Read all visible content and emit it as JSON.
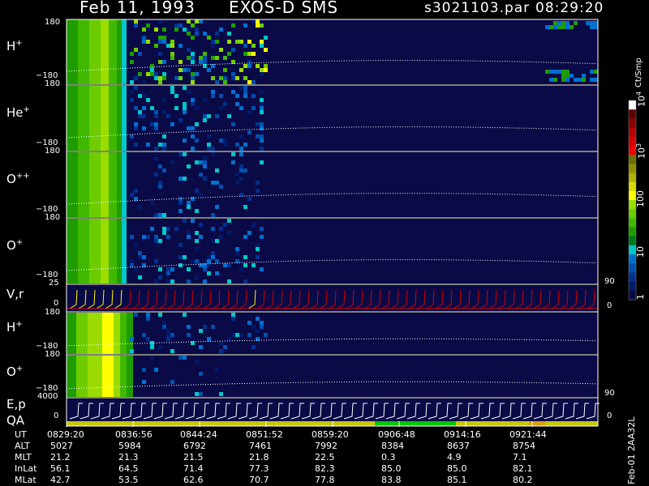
{
  "header": {
    "date": "Feb 11, 1993",
    "instrument": "EXOS-D SMS",
    "file": "s3021103.par",
    "time": "08:29:20"
  },
  "colorbar": {
    "unit": "Ct/Smp",
    "ticks": [
      "1",
      "10",
      "100",
      "10",
      "10"
    ],
    "tick_exponents": [
      "",
      "",
      "",
      "3",
      "4"
    ],
    "colors": [
      "#ffffff",
      "#5a0000",
      "#8a0000",
      "#b00000",
      "#d40000",
      "#f00000",
      "#6e6e00",
      "#8f8f00",
      "#b0b000",
      "#d8d800",
      "#ffff00",
      "#9adc00",
      "#6ccc00",
      "#40b800",
      "#1e9c00",
      "#007a20",
      "#00c8c8",
      "#0070d0",
      "#0050b0",
      "#003090",
      "#001a6a",
      "#0a0a46"
    ]
  },
  "panels": [
    {
      "label": "H",
      "sup": "+",
      "ytop": "180",
      "ybot": "−180",
      "right_label": ""
    },
    {
      "label": "He",
      "sup": "+",
      "ytop": "180",
      "ybot": "−180",
      "right_label": ""
    },
    {
      "label": "O",
      "sup": "++",
      "ytop": "180",
      "ybot": "−180",
      "right_label": ""
    },
    {
      "label": "O",
      "sup": "+",
      "ytop": "180",
      "ybot": "−180",
      "right_label": "90"
    },
    {
      "label": "V,r",
      "sup": "",
      "ytop": "25",
      "ybot": "0",
      "right_label": "0"
    },
    {
      "label": "H",
      "sup": "+",
      "ytop": "180",
      "ybot": "−180",
      "right_label": ""
    },
    {
      "label": "O",
      "sup": "+",
      "ytop": "180",
      "ybot": "−180",
      "right_label": "90"
    },
    {
      "label": "E,p",
      "sup": "",
      "ytop": "4000",
      "ybot": "0",
      "right_label": "0"
    }
  ],
  "qa_label": "QA",
  "orbit_table": {
    "row_labels": [
      "UT",
      "ALT",
      "MLT",
      "InLat",
      "MLat"
    ],
    "columns": [
      [
        "0829:20",
        "5027",
        "21.2",
        "56.1",
        "42.7"
      ],
      [
        "0836:56",
        "5984",
        "21.3",
        "64.5",
        "53.5"
      ],
      [
        "0844:24",
        "6792",
        "21.5",
        "71.4",
        "62.6"
      ],
      [
        "0851:52",
        "7461",
        "21.8",
        "77.3",
        "70.7"
      ],
      [
        "0859:20",
        "7992",
        "22.5",
        "82.3",
        "77.8"
      ],
      [
        "0906:48",
        "8384",
        "0.3",
        "85.0",
        "83.8"
      ],
      [
        "0914:16",
        "8637",
        "4.9",
        "85.0",
        "85.1"
      ],
      [
        "0921:44",
        "8754",
        "7.1",
        "82.1",
        "80.2"
      ]
    ]
  },
  "side_note": "Feb-01 2AA32L",
  "chart_data": {
    "type": "heatmap",
    "title": "Feb 11, 1993   EXOS-D SMS",
    "xlabel": "UT",
    "x_ticks": [
      "0829:20",
      "0836:56",
      "0844:24",
      "0851:52",
      "0859:20",
      "0906:48",
      "0914:16",
      "0921:44"
    ],
    "colorbar_unit": "Ct/Smp",
    "colorbar_range": [
      1,
      10000
    ],
    "colorbar_scale": "log",
    "series": [
      {
        "name": "H+",
        "ylim": [
          -180,
          180
        ]
      },
      {
        "name": "He+",
        "ylim": [
          -180,
          180
        ]
      },
      {
        "name": "O++",
        "ylim": [
          -180,
          180
        ]
      },
      {
        "name": "O+",
        "ylim": [
          -180,
          180
        ]
      },
      {
        "name": "V,r",
        "ylim": [
          0,
          25
        ]
      },
      {
        "name": "H+",
        "ylim": [
          -180,
          180
        ]
      },
      {
        "name": "O+",
        "ylim": [
          -180,
          180
        ]
      },
      {
        "name": "E,p",
        "ylim": [
          0,
          4000
        ]
      }
    ]
  }
}
